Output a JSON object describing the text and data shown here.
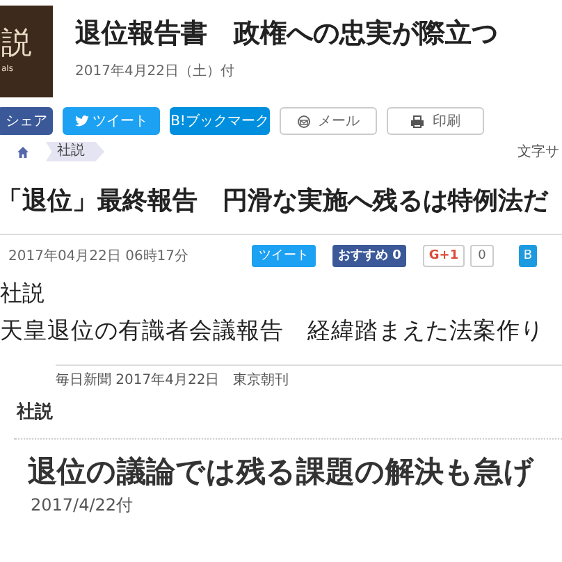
{
  "first_article": {
    "logo": {
      "mark": "説",
      "caption": "als"
    },
    "title": "退位報告書　政権への忠実が際立つ",
    "date": "2017年4月22日（土）付",
    "buttons": [
      {
        "kind": "share",
        "label": "シェア"
      },
      {
        "kind": "tweet",
        "label": "ツイート"
      },
      {
        "kind": "bookmark",
        "label": "B!ブックマーク"
      },
      {
        "kind": "mail",
        "label": "メール"
      },
      {
        "kind": "print",
        "label": "印刷"
      }
    ],
    "breadcrumb": [
      "社説"
    ],
    "font_size_label": "文字サ"
  },
  "second_article": {
    "title": "「退位」最終報告　円滑な実施へ残るは特例法だ",
    "date": "2017年04月22日 06時17分",
    "buttons": [
      {
        "kind": "tweet",
        "label": "ツイート"
      },
      {
        "kind": "recommend",
        "label": "おすすめ 0"
      },
      {
        "kind": "gplus",
        "label": "G+1"
      },
      {
        "kind": "count",
        "label": "0"
      },
      {
        "kind": "partial",
        "label": "B"
      }
    ]
  },
  "third_article": {
    "category": "社説",
    "title": "天皇退位の有識者会議報告　経緯踏まえた法案作り"
  },
  "fourth_article": {
    "source": "毎日新聞 2017年4月22日　東京朝刊",
    "category": "社説",
    "title": "退位の議論では残る課題の解決も急げ",
    "date": "2017/4/22付"
  }
}
